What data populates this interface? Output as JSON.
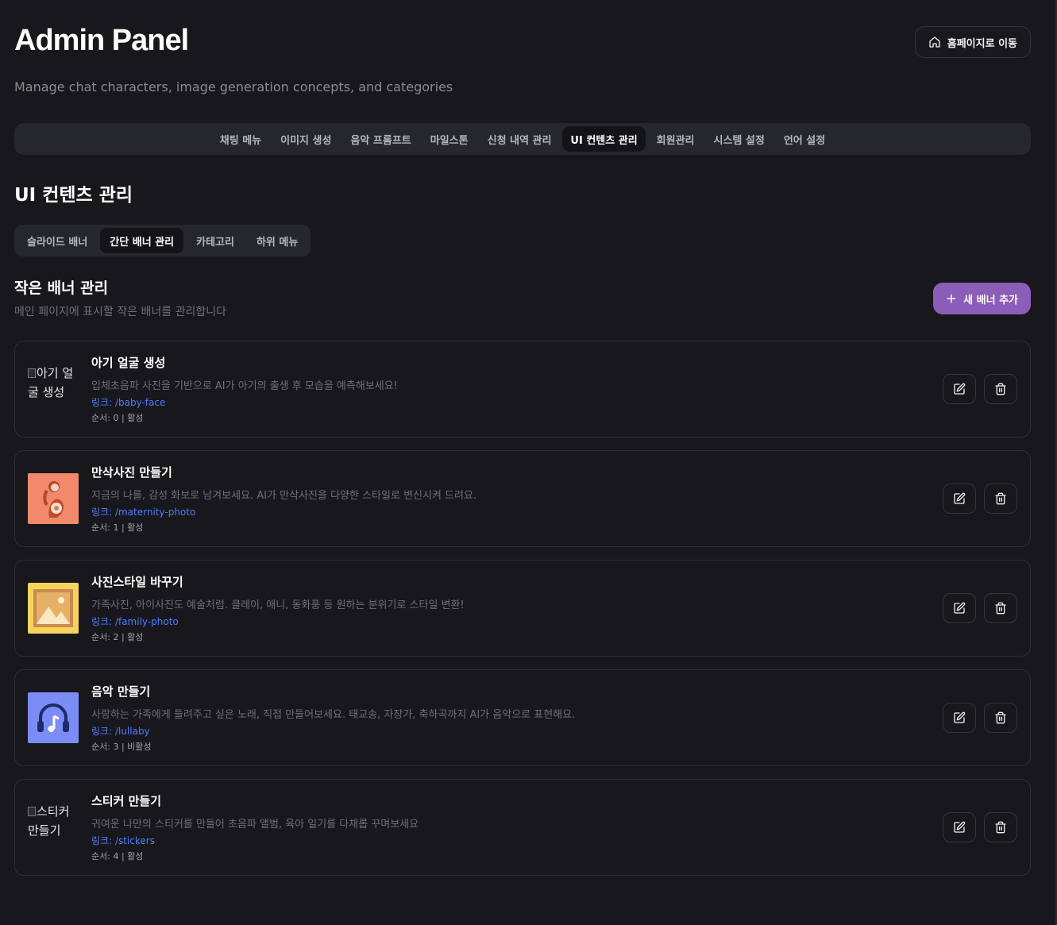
{
  "header": {
    "title": "Admin Panel",
    "subtitle": "Manage chat characters, image generation concepts, and categories",
    "home_button": "홈페이지로 이동"
  },
  "main_nav": {
    "tabs": [
      {
        "label": "채팅 메뉴",
        "active": false
      },
      {
        "label": "이미지 생성",
        "active": false
      },
      {
        "label": "음악 프롬프트",
        "active": false
      },
      {
        "label": "마일스톤",
        "active": false
      },
      {
        "label": "신청 내역 관리",
        "active": false
      },
      {
        "label": "UI 컨텐츠 관리",
        "active": true
      },
      {
        "label": "회원관리",
        "active": false
      },
      {
        "label": "시스템 설정",
        "active": false
      },
      {
        "label": "언어 설정",
        "active": false
      }
    ]
  },
  "section": {
    "title": "UI 컨텐츠 관리"
  },
  "sub_nav": {
    "tabs": [
      {
        "label": "슬라이드 배너",
        "active": false
      },
      {
        "label": "간단 배너 관리",
        "active": true
      },
      {
        "label": "카테고리",
        "active": false
      },
      {
        "label": "하위 메뉴",
        "active": false
      }
    ]
  },
  "list": {
    "title": "작은 배너 관리",
    "description": "메인 페이지에 표시할 작은 배너를 관리합니다",
    "add_button": "새 배너 추가"
  },
  "banners": [
    {
      "title": "아기 얼굴 생성",
      "description": "입체초음파 사진을 기반으로 AI가 아기의 출생 후 모습을 예측해보세요!",
      "link": "링크: /baby-face",
      "meta": "순서: 0 | 활성",
      "image": "broken",
      "image_alt": "아기 얼굴 생성",
      "icon": "broken-image-icon"
    },
    {
      "title": "만삭사진 만들기",
      "description": "지금의 나를, 감성 화보로 남겨보세요. AI가 만삭사진을 다양한 스타일로 변신시켜 드려요.",
      "link": "링크: /maternity-photo",
      "meta": "순서: 1 | 활성",
      "image": "maternity",
      "icon": "pregnant-woman-icon",
      "color": "#f2896a"
    },
    {
      "title": "사진스타일 바꾸기",
      "description": "가족사진, 아이사진도 예술처럼. 클레이, 애니, 동화풍 등 원하는 분위기로 스타일 변환!",
      "link": "링크: /family-photo",
      "meta": "순서: 2 | 활성",
      "image": "picture",
      "icon": "landscape-picture-icon",
      "color": "#f7d25c"
    },
    {
      "title": "음악 만들기",
      "description": "사랑하는 가족에게 들려주고 싶은 노래, 직접 만들어보세요. 태교송, 자장가, 축하곡까지 AI가 음악으로 표현해요.",
      "link": "링크: /lullaby",
      "meta": "순서: 3 | 비활성",
      "image": "music",
      "icon": "headphones-music-icon",
      "color": "#7b8cf7"
    },
    {
      "title": "스티커 만들기",
      "description": "귀여운 나만의 스티커를 만들어 초음파 앨범, 육아 일기를 다채롭 꾸며보세요",
      "link": "링크: /stickers",
      "meta": "순서: 4 | 활성",
      "image": "broken",
      "image_alt": "스티커 만들기",
      "icon": "broken-image-icon"
    }
  ]
}
